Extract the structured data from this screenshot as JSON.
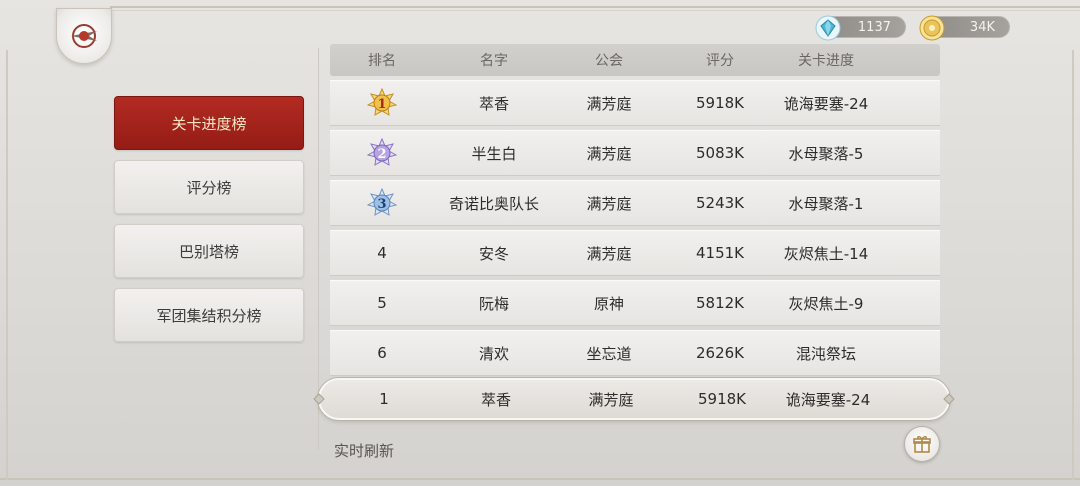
{
  "currency": {
    "gems": "1137",
    "gold": "34K"
  },
  "sidebar": {
    "items": [
      {
        "label": "关卡进度榜",
        "active": true
      },
      {
        "label": "评分榜",
        "active": false
      },
      {
        "label": "巴别塔榜",
        "active": false
      },
      {
        "label": "军团集结积分榜",
        "active": false
      }
    ]
  },
  "table": {
    "headers": {
      "rank": "排名",
      "name": "名字",
      "guild": "公会",
      "score": "评分",
      "progress": "关卡进度"
    },
    "rows": [
      {
        "rank": "1",
        "name": "萃香",
        "guild": "满芳庭",
        "score": "5918K",
        "progress": "诡海要塞-24"
      },
      {
        "rank": "2",
        "name": "半生白",
        "guild": "满芳庭",
        "score": "5083K",
        "progress": "水母聚落-5"
      },
      {
        "rank": "3",
        "name": "奇诺比奥队长",
        "guild": "满芳庭",
        "score": "5243K",
        "progress": "水母聚落-1"
      },
      {
        "rank": "4",
        "name": "安冬",
        "guild": "满芳庭",
        "score": "4151K",
        "progress": "灰烬焦土-14"
      },
      {
        "rank": "5",
        "name": "阮梅",
        "guild": "原神",
        "score": "5812K",
        "progress": "灰烬焦土-9"
      },
      {
        "rank": "6",
        "name": "清欢",
        "guild": "坐忘道",
        "score": "2626K",
        "progress": "混沌祭坛"
      }
    ]
  },
  "my_rank": {
    "rank": "1",
    "name": "萃香",
    "guild": "满芳庭",
    "score": "5918K",
    "progress": "诡海要塞-24"
  },
  "footer": {
    "refresh_label": "实时刷新"
  },
  "colors": {
    "active_tab": "#a42319",
    "medal_gold": "#e9b33a",
    "medal_silver": "#9d86d6",
    "medal_bronze": "#7fa7d9"
  }
}
